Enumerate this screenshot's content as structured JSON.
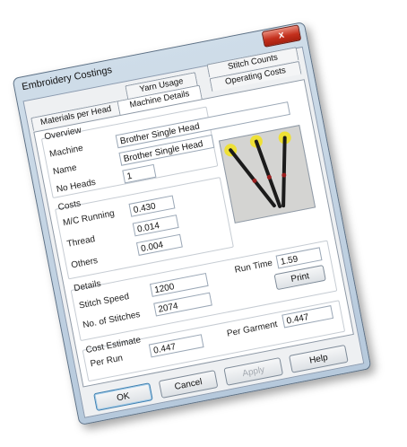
{
  "window": {
    "title": "Embroidery Costings",
    "close_label": "x"
  },
  "tabs": {
    "row1": [
      "Yarn Usage",
      "Stitch Counts",
      "Operating Costs"
    ],
    "row2": [
      "Materials per Head",
      "Machine Details"
    ]
  },
  "overview": {
    "heading": "Overview",
    "machine_label": "Machine",
    "machine_value": "Brother Single Head",
    "name_label": "Name",
    "name_value": "Brother Single Head",
    "heads_label": "No Heads",
    "heads_value": "1"
  },
  "costs": {
    "heading": "Costs",
    "mc_running_label": "M/C Running",
    "mc_running_value": "0.430",
    "thread_label": "Thread",
    "thread_value": "0.014",
    "others_label": "Others",
    "others_value": "0.004"
  },
  "details": {
    "heading": "Details",
    "stitch_speed_label": "Stitch Speed",
    "stitch_speed_value": "1200",
    "stitches_label": "No. of Stitches",
    "stitches_value": "2074",
    "run_time_label": "Run Time",
    "run_time_value": "1.59",
    "print_label": "Print"
  },
  "estimate": {
    "heading": "Cost Estimate",
    "per_run_label": "Per Run",
    "per_run_value": "0.447",
    "per_garment_label": "Per Garment",
    "per_garment_value": "0.447"
  },
  "buttons": {
    "ok": "OK",
    "cancel": "Cancel",
    "apply": "Apply",
    "help": "Help"
  },
  "image": {
    "needle_colors": [
      "#f2e21b",
      "#f2e21b",
      "#f2e21b"
    ],
    "needle_body": "#1b1b1b",
    "handle_accent": "#9b1d1d"
  }
}
